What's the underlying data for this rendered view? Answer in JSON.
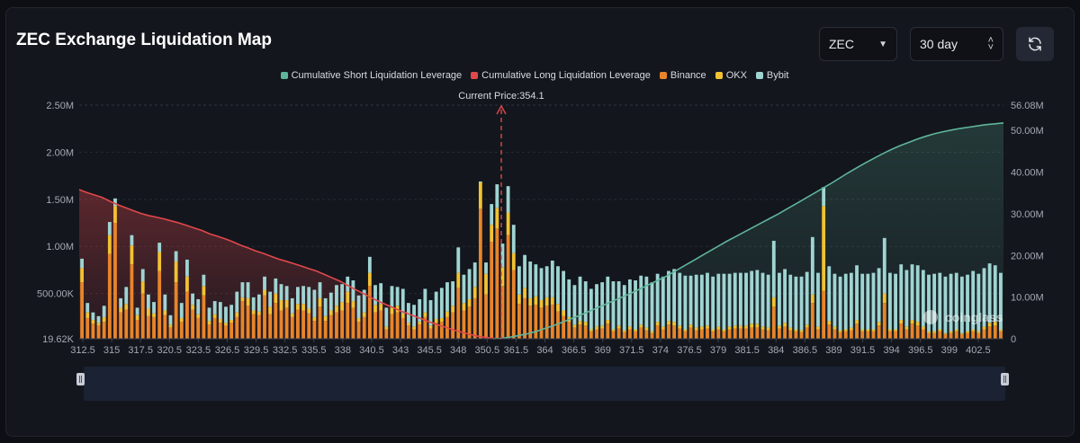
{
  "header": {
    "title": "ZEC Exchange Liquidation Map",
    "coin_select": "ZEC",
    "range_select": "30 day"
  },
  "legend": [
    {
      "label": "Cumulative Short Liquidation Leverage",
      "color": "#5fb59a"
    },
    {
      "label": "Cumulative Long Liquidation Leverage",
      "color": "#e0484b"
    },
    {
      "label": "Binance",
      "color": "#e8852a"
    },
    {
      "label": "OKX",
      "color": "#f2c233"
    },
    {
      "label": "Bybit",
      "color": "#9fd4d2"
    }
  ],
  "icons": [
    "chevron-down-icon",
    "up-down-arrows-icon",
    "refresh-icon",
    "coinglass-logo"
  ],
  "watermark": "coinglass",
  "chart_data": {
    "type": "bar",
    "current_price_label": "Current Price:354.1",
    "current_price": 354.1,
    "x_tick_labels": [
      "312.5",
      "315",
      "317.5",
      "320.5",
      "323.5",
      "326.5",
      "329.5",
      "332.5",
      "335.5",
      "338",
      "340.5",
      "343",
      "345.5",
      "348",
      "350.5",
      "361.5",
      "364",
      "366.5",
      "369",
      "371.5",
      "374",
      "376.5",
      "379",
      "381.5",
      "384",
      "386.5",
      "389",
      "391.5",
      "394",
      "396.5",
      "399",
      "402.5"
    ],
    "left_axis": {
      "ticks": [
        "19.62K",
        "500.00K",
        "1.00M",
        "1.50M",
        "2.00M",
        "2.50M"
      ],
      "values": [
        19620,
        500000,
        1000000,
        1500000,
        2000000,
        2500000
      ],
      "range": [
        19620,
        2500000
      ]
    },
    "right_axis": {
      "ticks": [
        "0",
        "10.00M",
        "20.00M",
        "30.00M",
        "40.00M",
        "50.00M",
        "56.08M"
      ],
      "values": [
        0,
        10000000,
        20000000,
        30000000,
        40000000,
        50000000,
        56080000
      ],
      "range": [
        0,
        56080000
      ]
    },
    "series": [
      {
        "name": "Binance",
        "values": [
          600000,
          220000,
          160000,
          140000,
          180000,
          900000,
          1230000,
          280000,
          310000,
          790000,
          200000,
          480000,
          240000,
          230000,
          720000,
          250000,
          120000,
          600000,
          180000,
          500000,
          310000,
          220000,
          460000,
          150000,
          220000,
          170000,
          140000,
          170000,
          230000,
          400000,
          350000,
          260000,
          250000,
          460000,
          260000,
          380000,
          300000,
          330000,
          230000,
          310000,
          300000,
          270000,
          190000,
          340000,
          190000,
          250000,
          280000,
          300000,
          380000,
          330000,
          180000,
          230000,
          560000,
          280000,
          300000,
          100000,
          260000,
          280000,
          220000,
          140000,
          100000,
          150000,
          230000,
          110000,
          170000,
          180000,
          230000,
          280000,
          540000,
          300000,
          340000,
          430000,
          1380000,
          470000,
          1030000,
          1170000,
          560000,
          1100000,
          730000,
          370000,
          430000,
          350000,
          360000,
          330000,
          350000,
          360000,
          290000,
          240000,
          180000,
          120000,
          150000,
          140000,
          80000,
          100000,
          110000,
          160000,
          80000,
          110000,
          70000,
          100000,
          80000,
          120000,
          90000,
          60000,
          140000,
          100000,
          150000,
          140000,
          110000,
          80000,
          120000,
          90000,
          100000,
          110000,
          80000,
          100000,
          80000,
          100000,
          110000,
          110000,
          110000,
          120000,
          120000,
          100000,
          90000,
          340000,
          110000,
          130000,
          90000,
          80000,
          70000,
          120000,
          380000,
          100000,
          510000,
          150000,
          100000,
          70000,
          80000,
          90000,
          160000,
          80000,
          80000,
          80000,
          140000,
          380000,
          80000,
          80000,
          160000,
          100000,
          160000,
          140000,
          100000,
          60000,
          60000,
          80000,
          50000,
          60000,
          80000,
          50000,
          60000,
          80000,
          60000,
          100000,
          130000,
          140000,
          80000
        ]
      },
      {
        "name": "OKX",
        "values": [
          150000,
          60000,
          40000,
          30000,
          50000,
          200000,
          180000,
          50000,
          60000,
          200000,
          50000,
          130000,
          80000,
          40000,
          200000,
          50000,
          30000,
          220000,
          40000,
          160000,
          50000,
          40000,
          100000,
          40000,
          40000,
          40000,
          30000,
          30000,
          50000,
          40000,
          80000,
          40000,
          40000,
          60000,
          80000,
          100000,
          110000,
          80000,
          40000,
          60000,
          70000,
          50000,
          40000,
          90000,
          50000,
          50000,
          70000,
          90000,
          120000,
          70000,
          40000,
          50000,
          140000,
          80000,
          70000,
          30000,
          70000,
          70000,
          50000,
          30000,
          30000,
          30000,
          50000,
          30000,
          40000,
          40000,
          60000,
          70000,
          160000,
          80000,
          80000,
          120000,
          280000,
          220000,
          180000,
          220000,
          200000,
          240000,
          180000,
          100000,
          110000,
          80000,
          90000,
          80000,
          90000,
          80000,
          80000,
          60000,
          50000,
          30000,
          40000,
          40000,
          20000,
          30000,
          30000,
          40000,
          20000,
          30000,
          20000,
          30000,
          20000,
          30000,
          30000,
          20000,
          40000,
          30000,
          40000,
          40000,
          30000,
          20000,
          30000,
          30000,
          30000,
          30000,
          20000,
          30000,
          20000,
          30000,
          30000,
          30000,
          30000,
          40000,
          40000,
          30000,
          30000,
          100000,
          30000,
          40000,
          30000,
          20000,
          20000,
          30000,
          90000,
          30000,
          900000,
          40000,
          30000,
          20000,
          20000,
          30000,
          40000,
          20000,
          20000,
          20000,
          40000,
          100000,
          20000,
          20000,
          40000,
          30000,
          40000,
          40000,
          30000,
          20000,
          20000,
          20000,
          10000,
          20000,
          20000,
          10000,
          20000,
          20000,
          20000,
          30000,
          40000,
          40000,
          20000
        ]
      },
      {
        "name": "Bybit",
        "values": [
          100000,
          100000,
          80000,
          70000,
          120000,
          140000,
          80000,
          100000,
          180000,
          110000,
          80000,
          130000,
          150000,
          120000,
          100000,
          170000,
          100000,
          110000,
          160000,
          180000,
          120000,
          160000,
          120000,
          140000,
          140000,
          180000,
          170000,
          160000,
          220000,
          160000,
          170000,
          140000,
          180000,
          140000,
          160000,
          160000,
          170000,
          150000,
          160000,
          180000,
          190000,
          230000,
          290000,
          170000,
          190000,
          190000,
          220000,
          190000,
          160000,
          220000,
          240000,
          240000,
          170000,
          210000,
          220000,
          200000,
          230000,
          200000,
          260000,
          210000,
          230000,
          240000,
          250000,
          270000,
          290000,
          320000,
          310000,
          260000,
          270000,
          300000,
          320000,
          260000,
          10000,
          120000,
          220000,
          250000,
          250000,
          280000,
          300000,
          300000,
          350000,
          390000,
          340000,
          340000,
          330000,
          390000,
          400000,
          420000,
          400000,
          420000,
          470000,
          430000,
          430000,
          450000,
          460000,
          460000,
          510000,
          470000,
          480000,
          500000,
          520000,
          520000,
          540000,
          520000,
          510000,
          530000,
          530000,
          560000,
          560000,
          570000,
          520000,
          560000,
          550000,
          560000,
          560000,
          560000,
          590000,
          560000,
          560000,
          560000,
          560000,
          560000,
          570000,
          570000,
          560000,
          600000,
          560000,
          570000,
          560000,
          560000,
          570000,
          560000,
          610000,
          570000,
          200000,
          580000,
          560000,
          570000,
          590000,
          580000,
          580000,
          590000,
          590000,
          600000,
          570000,
          590000,
          600000,
          590000,
          590000,
          600000,
          590000,
          600000,
          600000,
          600000,
          610000,
          600000,
          600000,
          610000,
          600000,
          600000,
          600000,
          620000,
          610000,
          620000,
          630000,
          600000,
          600000
        ]
      }
    ],
    "cumulative_long": {
      "name": "Cumulative Long Liquidation Leverage",
      "values": [
        35.8,
        35.1,
        34.5,
        33.9,
        33.0,
        32.2,
        31.5,
        30.8,
        30.1,
        29.6,
        29.2,
        28.8,
        28.3,
        27.8,
        27.2,
        26.6,
        26.0,
        25.2,
        24.6,
        24.0,
        23.3,
        22.5,
        21.8,
        21.1,
        20.5,
        19.8,
        19.1,
        18.6,
        18.0,
        17.4,
        16.8,
        16.2,
        15.4,
        14.6,
        13.8,
        12.8,
        11.8,
        10.9,
        9.9,
        9.0,
        8.2,
        7.4,
        6.6,
        5.9,
        5.2,
        4.5,
        3.8,
        3.2,
        2.6,
        2.0,
        1.5,
        1.0,
        0.6,
        0.3,
        0.1,
        0.0
      ]
    },
    "cumulative_short": {
      "name": "Cumulative Short Liquidation Leverage",
      "values": [
        0.0,
        0.1,
        0.4,
        0.8,
        1.2,
        1.8,
        2.5,
        3.2,
        4.0,
        4.8,
        5.6,
        6.5,
        7.4,
        8.3,
        9.2,
        10.1,
        11.0,
        12.0,
        13.0,
        14.0,
        15.0,
        16.2,
        17.4,
        18.6,
        19.8,
        21.0,
        22.2,
        23.4,
        24.5,
        25.6,
        26.7,
        27.8,
        28.9,
        30.0,
        31.2,
        32.4,
        33.6,
        34.8,
        36.0,
        37.2,
        38.5,
        39.8,
        41.0,
        42.2,
        43.3,
        44.4,
        45.4,
        46.3,
        47.1,
        47.9,
        48.6,
        49.2,
        49.7,
        50.1,
        50.5,
        50.8,
        51.1,
        51.4,
        51.6,
        51.8
      ]
    },
    "grid": true,
    "legend_position": "top-center"
  }
}
